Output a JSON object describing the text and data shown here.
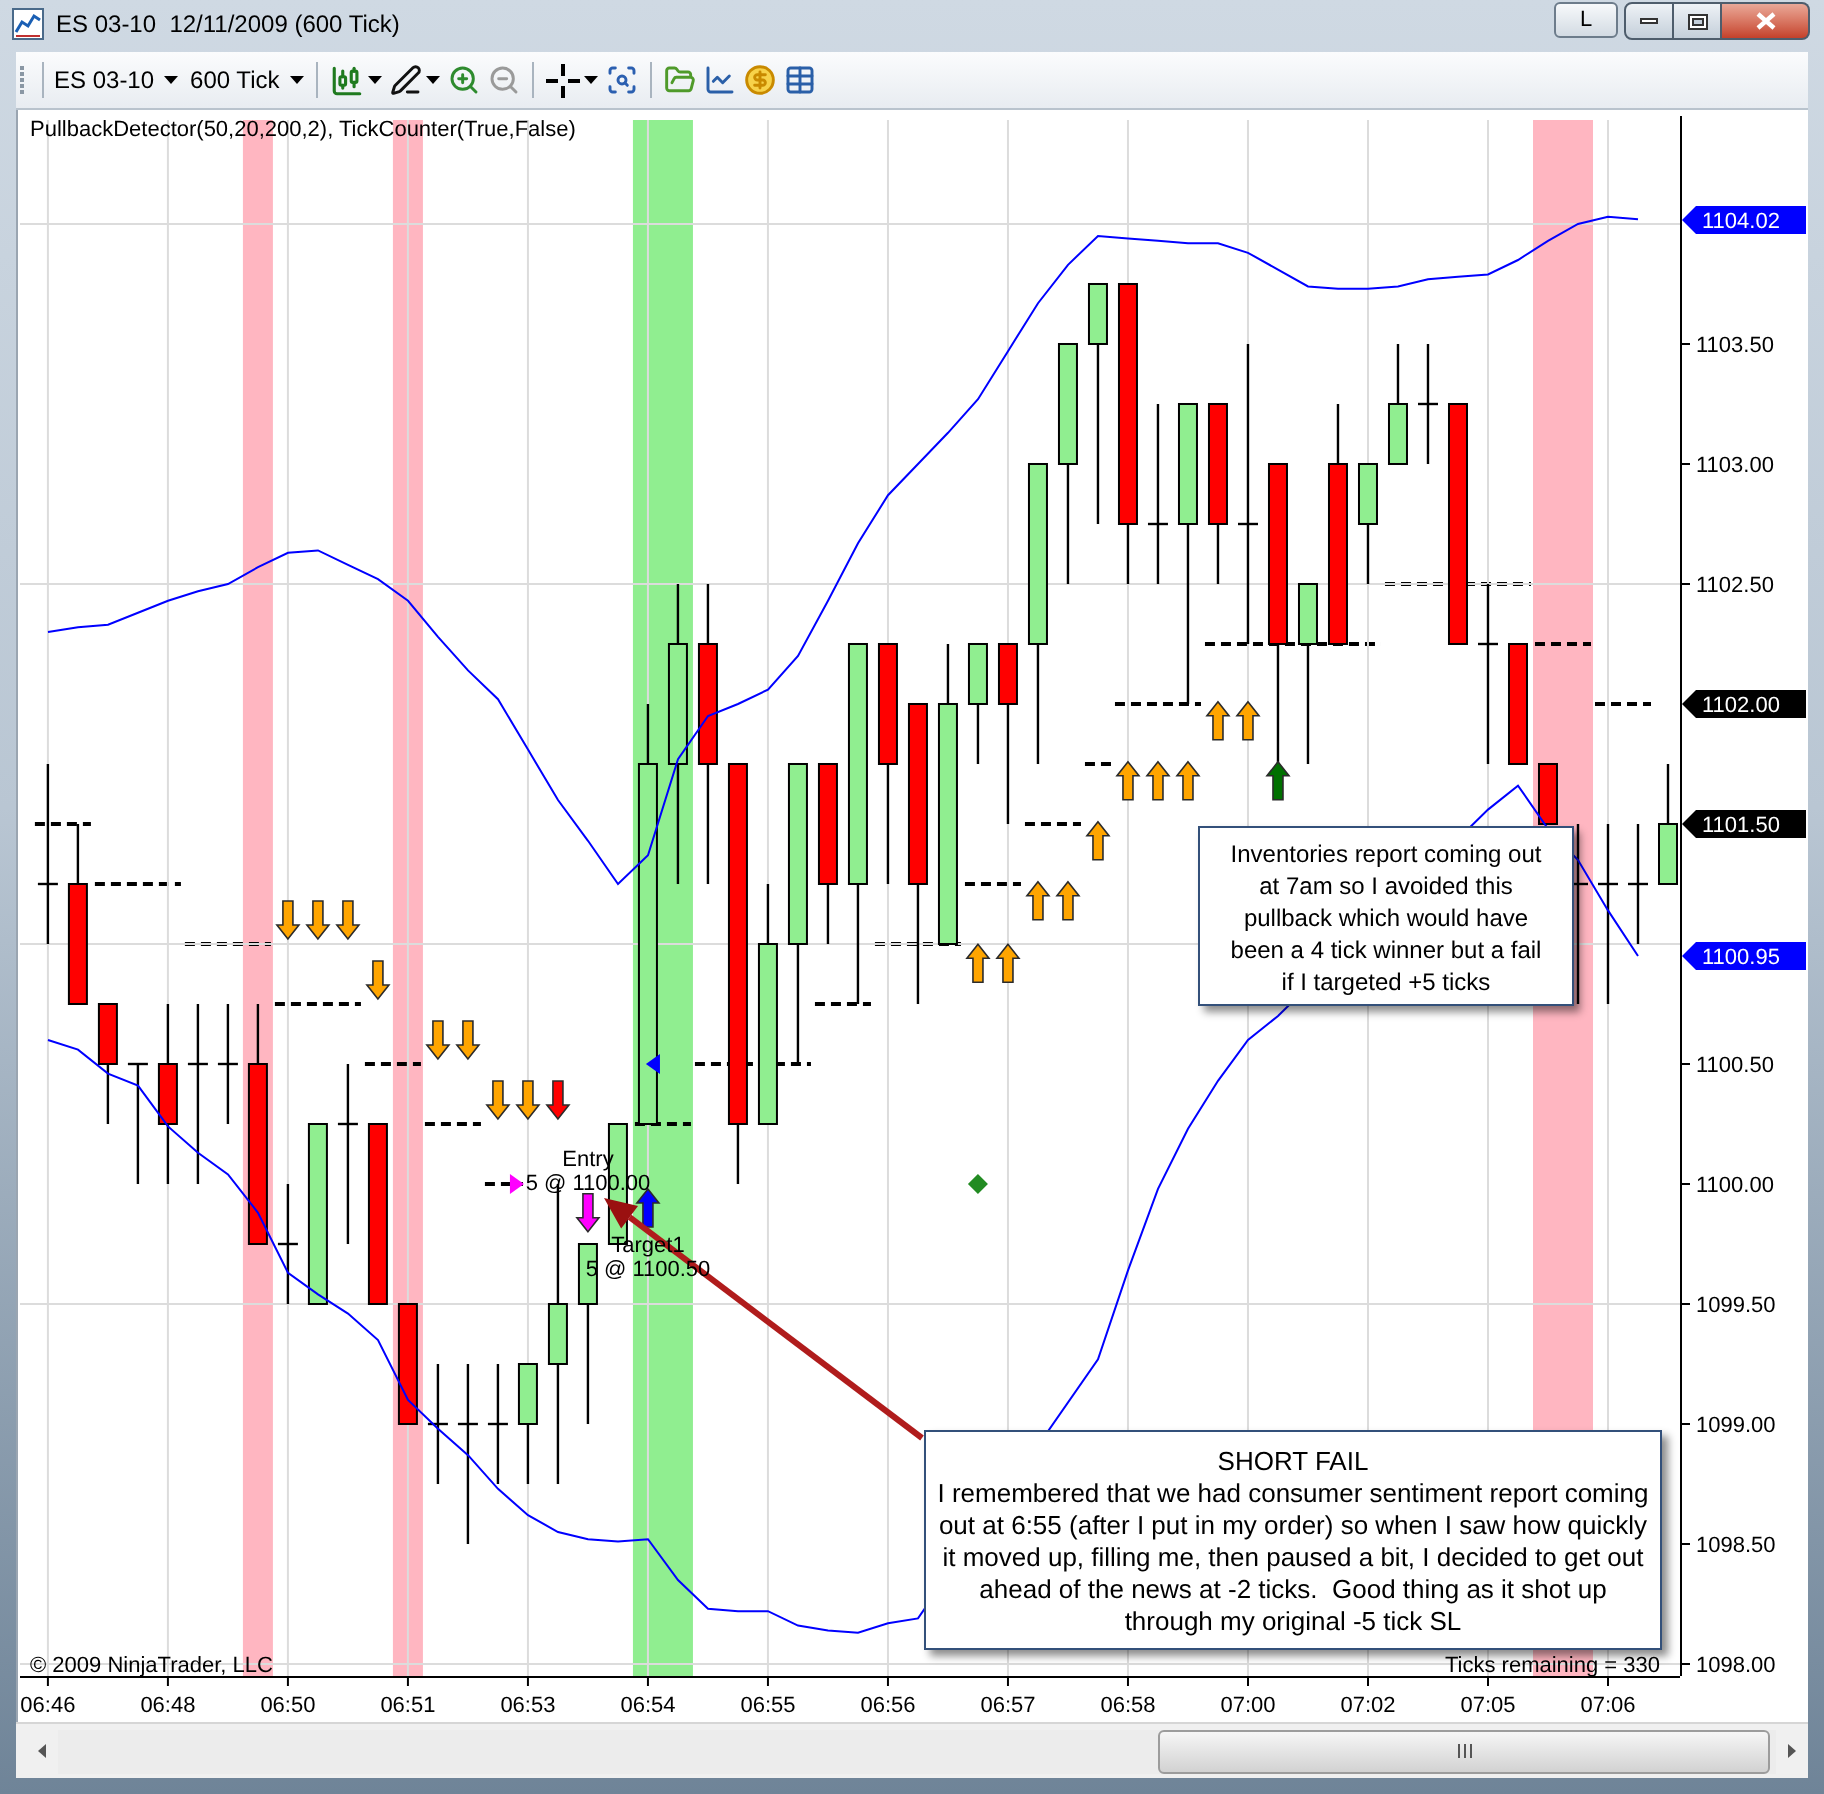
{
  "window": {
    "title": "ES 03-10  12/11/2009 (600 Tick)",
    "button_label": "L"
  },
  "toolbar": {
    "instrument": "ES 03-10",
    "interval": "600 Tick"
  },
  "chart": {
    "indicator_label": "PullbackDetector(50,20,200,2), TickCounter(True,False)",
    "copyright": "© 2009 NinjaTrader, LLC",
    "ticks_remaining": "Ticks remaining = 330",
    "price_tags": [
      {
        "label": "1104.02",
        "color": "#0000ff"
      },
      {
        "label": "1102.00",
        "color": "#000000"
      },
      {
        "label": "1101.50",
        "color": "#000000"
      },
      {
        "label": "1100.95",
        "color": "#0000ff"
      }
    ],
    "order_labels": [
      {
        "name": "Entry",
        "fill": "5 @ 1100.00"
      },
      {
        "name": "Target1",
        "fill": "5 @ 1100.50"
      }
    ],
    "notes": [
      {
        "text": "Inventories report coming out\nat 7am so I avoided this\npullback which would have\nbeen a 4 tick winner but a fail\nif I targeted +5 ticks"
      },
      {
        "title": "SHORT FAIL",
        "text": "I remembered that we had consumer sentiment report coming\nout at 6:55 (after I put in my order) so when I saw how quickly\nit moved up, filling me, then paused a bit, I decided to get out\nahead of the news at -2 ticks.  Good thing as it shot up\nthrough my original -5 tick SL"
      }
    ],
    "chart_data": {
      "type": "candlestick",
      "grid": true,
      "categories": [
        "06:46",
        null,
        null,
        null,
        "06:48",
        null,
        null,
        null,
        "06:50",
        null,
        null,
        null,
        "06:51",
        null,
        null,
        null,
        "06:53",
        null,
        null,
        null,
        "06:54",
        null,
        null,
        null,
        "06:55",
        null,
        null,
        null,
        "06:56",
        null,
        null,
        null,
        "06:57",
        null,
        null,
        null,
        "06:58",
        null,
        null,
        null,
        "07:00",
        null,
        null,
        null,
        "07:02",
        null,
        null,
        null,
        "07:05",
        null,
        null,
        null,
        "07:06",
        null,
        null
      ],
      "ylim": [
        1097.95,
        1104.4333
      ],
      "yticks": [
        {
          "value": 1103.5,
          "label": "1103.50"
        },
        {
          "value": 1103,
          "label": "1103.00"
        },
        {
          "value": 1102.5,
          "label": "1102.50"
        },
        {
          "value": 1100.5,
          "label": "1100.50"
        },
        {
          "value": 1100,
          "label": "1100.00"
        },
        {
          "value": 1099.5,
          "label": "1099.50"
        },
        {
          "value": 1099,
          "label": "1099.00"
        },
        {
          "value": 1098.5,
          "label": "1098.50"
        },
        {
          "value": 1098,
          "label": "1098.00"
        }
      ],
      "ohlc": [
        [
          1101.25,
          1101.75,
          1101.0,
          1101.25
        ],
        [
          1101.25,
          1101.5,
          1100.75,
          1100.75
        ],
        [
          1100.75,
          1100.75,
          1100.25,
          1100.5
        ],
        [
          1100.5,
          1100.5,
          1100.0,
          1100.5
        ],
        [
          1100.5,
          1100.75,
          1100.0,
          1100.25
        ],
        [
          1100.5,
          1100.75,
          1100.0,
          1100.5
        ],
        [
          1100.5,
          1100.75,
          1100.25,
          1100.5
        ],
        [
          1100.5,
          1100.75,
          1099.75,
          1099.75
        ],
        [
          1099.75,
          1100.0,
          1099.5,
          1099.75
        ],
        [
          1099.5,
          1100.25,
          1099.5,
          1100.25
        ],
        [
          1100.25,
          1100.5,
          1099.75,
          1100.25
        ],
        [
          1100.25,
          1100.25,
          1099.5,
          1099.5
        ],
        [
          1099.5,
          1099.5,
          1099.0,
          1099.0
        ],
        [
          1099.0,
          1099.25,
          1098.75,
          1099.0
        ],
        [
          1099.0,
          1099.25,
          1098.5,
          1099.0
        ],
        [
          1099.0,
          1099.25,
          1098.75,
          1099.0
        ],
        [
          1099.0,
          1099.25,
          1098.75,
          1099.25
        ],
        [
          1099.25,
          1100.0,
          1098.75,
          1099.5
        ],
        [
          1099.5,
          1099.75,
          1099.0,
          1099.75
        ],
        [
          1099.75,
          1100.25,
          1099.75,
          1100.25
        ],
        [
          1100.25,
          1102.0,
          1100.25,
          1101.75
        ],
        [
          1101.75,
          1102.5,
          1101.25,
          1102.25
        ],
        [
          1102.25,
          1102.5,
          1101.25,
          1101.75
        ],
        [
          1101.75,
          1101.75,
          1100.0,
          1100.25
        ],
        [
          1100.25,
          1101.25,
          1100.25,
          1101.0
        ],
        [
          1101.0,
          1101.75,
          1100.5,
          1101.75
        ],
        [
          1101.75,
          1101.75,
          1101.0,
          1101.25
        ],
        [
          1101.25,
          1102.25,
          1100.75,
          1102.25
        ],
        [
          1102.25,
          1102.25,
          1101.25,
          1101.75
        ],
        [
          1102.0,
          1102.0,
          1100.75,
          1101.25
        ],
        [
          1101.0,
          1102.25,
          1101.0,
          1102.0
        ],
        [
          1102.0,
          1102.25,
          1101.75,
          1102.25
        ],
        [
          1102.25,
          1102.25,
          1101.5,
          1102.0
        ],
        [
          1102.25,
          1103.0,
          1101.75,
          1103.0
        ],
        [
          1103.0,
          1103.5,
          1102.5,
          1103.5
        ],
        [
          1103.5,
          1103.75,
          1102.75,
          1103.75
        ],
        [
          1103.75,
          1103.75,
          1102.5,
          1102.75
        ],
        [
          1102.75,
          1103.25,
          1102.5,
          1102.75
        ],
        [
          1102.75,
          1103.25,
          1102.0,
          1103.25
        ],
        [
          1103.25,
          1103.25,
          1102.5,
          1102.75
        ],
        [
          1102.75,
          1103.5,
          1102.25,
          1102.75
        ],
        [
          1103.0,
          1103.0,
          1101.75,
          1102.25
        ],
        [
          1102.25,
          1102.5,
          1101.75,
          1102.5
        ],
        [
          1103.0,
          1103.25,
          1102.25,
          1102.25
        ],
        [
          1102.75,
          1103.0,
          1102.5,
          1103.0
        ],
        [
          1103.0,
          1103.5,
          1103.0,
          1103.25
        ],
        [
          1103.25,
          1103.5,
          1103.0,
          1103.25
        ],
        [
          1103.25,
          1103.25,
          1102.25,
          1102.25
        ],
        [
          1102.25,
          1102.5,
          1101.75,
          1102.25
        ],
        [
          1102.25,
          1102.25,
          1101.75,
          1101.75
        ],
        [
          1101.75,
          1101.75,
          1101.5,
          1101.5
        ],
        [
          1101.25,
          1101.5,
          1100.75,
          1101.25
        ],
        [
          1101.25,
          1101.5,
          1100.75,
          1101.25
        ],
        [
          1101.25,
          1101.5,
          1101.0,
          1101.25
        ],
        [
          1101.25,
          1101.75,
          1101.25,
          1101.5
        ]
      ],
      "series": [
        {
          "type": "line",
          "color": "#0000ff",
          "values": [
            1102.3,
            1102.32,
            1102.33,
            1102.38,
            1102.43,
            1102.47,
            1102.5,
            1102.57,
            1102.63,
            1102.64,
            1102.58,
            1102.52,
            1102.43,
            1102.28,
            1102.14,
            1102.02,
            1101.81,
            1101.6,
            1101.43,
            1101.25,
            1101.37,
            1101.77,
            1101.95,
            1102.0,
            1102.06,
            1102.2,
            1102.43,
            1102.67,
            1102.87,
            1103.0,
            1103.13,
            1103.27,
            1103.47,
            1103.67,
            1103.83,
            1103.95,
            1103.94,
            1103.93,
            1103.92,
            1103.92,
            1103.88,
            1103.81,
            1103.74,
            1103.73,
            1103.73,
            1103.74,
            1103.77,
            1103.78,
            1103.79,
            1103.85,
            1103.93,
            1104.0,
            1104.03,
            1104.02,
            null
          ]
        },
        {
          "type": "line",
          "color": "#0000ff",
          "values": [
            1100.6,
            1100.56,
            1100.46,
            1100.41,
            1100.24,
            1100.13,
            1100.04,
            1099.88,
            1099.63,
            1099.54,
            1099.46,
            1099.35,
            1099.1,
            1098.98,
            1098.87,
            1098.73,
            1098.62,
            1098.55,
            1098.52,
            1098.51,
            1098.52,
            1098.35,
            1098.23,
            1098.22,
            1098.22,
            1098.16,
            1098.14,
            1098.13,
            1098.17,
            1098.19,
            null,
            null,
            null,
            null,
            null,
            1099.27,
            1099.64,
            1099.98,
            1100.23,
            1100.43,
            1100.6,
            1100.7,
            null,
            null,
            null,
            null,
            null,
            null,
            1101.56,
            1101.66,
            1101.48,
            1101.35,
            1101.14,
            1100.95,
            null
          ]
        }
      ]
    }
  }
}
